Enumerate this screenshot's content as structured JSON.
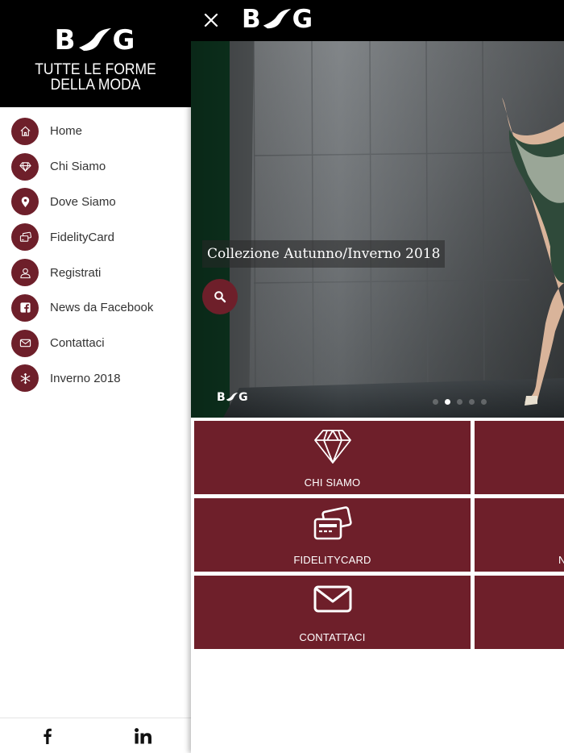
{
  "sidebar": {
    "brand": {
      "wordmark": "B G",
      "tagline_1": "TUTTE LE FORME",
      "tagline_2": "DELLA MODA"
    },
    "menu": [
      {
        "label": "Home",
        "icon": "home-icon"
      },
      {
        "label": "Chi Siamo",
        "icon": "diamond-icon"
      },
      {
        "label": "Dove Siamo",
        "icon": "location-pin-icon"
      },
      {
        "label": "FidelityCard",
        "icon": "cards-icon"
      },
      {
        "label": "Registrati",
        "icon": "user-icon"
      },
      {
        "label": "News da Facebook",
        "icon": "facebook-icon"
      },
      {
        "label": "Contattaci",
        "icon": "envelope-icon"
      },
      {
        "label": "Inverno 2018",
        "icon": "snowflake-icon"
      }
    ],
    "social": [
      {
        "name": "facebook-icon"
      },
      {
        "name": "linkedin-icon"
      }
    ]
  },
  "header": {
    "logo": "B G"
  },
  "hero": {
    "caption": "Collezione Autunno/Inverno 2018",
    "watermark": "B G",
    "slides_total": 5,
    "active_slide": 1
  },
  "tiles": [
    {
      "label": "CHI SIAMO",
      "icon": "diamond-icon"
    },
    {
      "label": "",
      "icon": ""
    },
    {
      "label": "FIDELITYCARD",
      "icon": "cards-icon"
    },
    {
      "label": "N",
      "icon": ""
    },
    {
      "label": "CONTATTACI",
      "icon": "envelope-icon"
    },
    {
      "label": "",
      "icon": ""
    }
  ],
  "colors": {
    "accent": "#6e1f2a",
    "bar": "#000000",
    "text": "#333333"
  }
}
